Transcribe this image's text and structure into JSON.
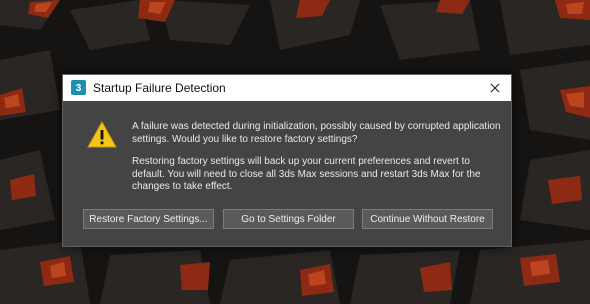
{
  "window": {
    "title": "Startup Failure Detection",
    "app_icon": "3ds-max-app-icon",
    "close_icon": "close-icon"
  },
  "dialog": {
    "icon": "warning-icon",
    "message_1": "A failure was detected during initialization, possibly caused by corrupted application settings. Would you like to restore factory settings?",
    "message_2": "Restoring factory settings will back up your current preferences and revert to default. You will need to close all 3ds Max sessions and restart 3ds Max for the changes to take effect."
  },
  "buttons": {
    "restore": "Restore Factory Settings...",
    "settings_folder": "Go to Settings Folder",
    "continue": "Continue Without Restore"
  },
  "colors": {
    "dialog_bg": "#444444",
    "titlebar_bg": "#ffffff",
    "button_bg": "#5a5a5a",
    "warning_yellow": "#f5c518",
    "wallpaper_accent": "#a8331a"
  }
}
